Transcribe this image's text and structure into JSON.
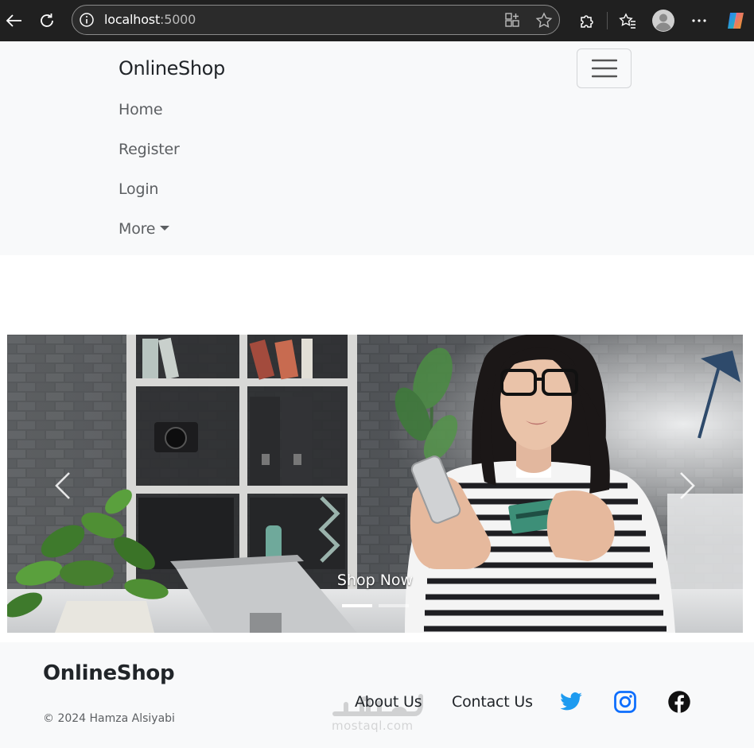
{
  "browser": {
    "url_host": "localhost",
    "url_port": ":5000",
    "icons": [
      "back-icon",
      "refresh-icon",
      "site-info-icon",
      "app-grid-icon",
      "favorite-star-icon",
      "extensions-icon",
      "favorites-icon",
      "profile-avatar-icon",
      "more-icon",
      "copilot-icon"
    ]
  },
  "navbar": {
    "brand": "OnlineShop",
    "items": [
      {
        "label": "Home"
      },
      {
        "label": "Register"
      },
      {
        "label": "Login"
      },
      {
        "label": "More"
      }
    ],
    "toggler_icon": "hamburger-icon"
  },
  "carousel": {
    "caption": "Shop Now",
    "slide_count": 2,
    "active_index": 0,
    "prev_icon": "chevron-left-icon",
    "next_icon": "chevron-right-icon"
  },
  "footer": {
    "brand": "OnlineShop",
    "copyright": "© 2024 Hamza Alsiyabi",
    "links": [
      {
        "label": "About Us"
      },
      {
        "label": "Contact Us"
      }
    ],
    "social": [
      {
        "icon": "twitter-icon",
        "color": "#1d9bf0"
      },
      {
        "icon": "instagram-icon",
        "color": "#0d6efd"
      },
      {
        "icon": "facebook-icon",
        "color": "#111111"
      }
    ],
    "watermark": "mostaql.com"
  }
}
